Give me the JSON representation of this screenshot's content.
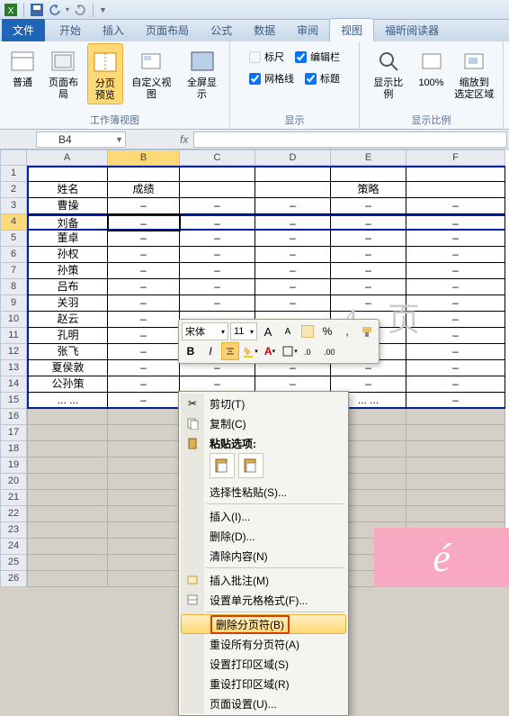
{
  "titlebar": {
    "app_icon": "excel-icon",
    "save_icon": "save-icon",
    "undo_icon": "undo-icon",
    "redo_icon": "redo-icon"
  },
  "tabs": {
    "file": "文件",
    "items": [
      "开始",
      "插入",
      "页面布局",
      "公式",
      "数据",
      "审阅",
      "视图",
      "福昕阅读器"
    ],
    "active_index": 6
  },
  "ribbon": {
    "group1": {
      "normal": "普通",
      "page_layout": "页面布局",
      "page_break": "分页\n预览",
      "custom_view": "自定义视图",
      "full_screen": "全屏显示",
      "label": "工作簿视图"
    },
    "group2": {
      "ruler": "标尺",
      "formula_bar": "编辑栏",
      "gridlines": "网格线",
      "headings": "标题",
      "label": "显示"
    },
    "group3": {
      "zoom": "显示比例",
      "hundred": "100%",
      "zoom_selection": "缩放到\n选定区域",
      "label": "显示比例"
    }
  },
  "namebox": {
    "value": "B4",
    "fx": "fx"
  },
  "columns": [
    "A",
    "B",
    "C",
    "D",
    "E",
    "F"
  ],
  "col_header_b": "成绩",
  "col_header_e": "策略",
  "rows": [
    {
      "n": 1,
      "a": "",
      "b": "",
      "c": "",
      "d": "",
      "e": "",
      "f": ""
    },
    {
      "n": 2,
      "a": "姓名",
      "b": "成绩",
      "c": "",
      "d": "",
      "e": "策略",
      "f": ""
    },
    {
      "n": 3,
      "a": "曹操",
      "b": "–",
      "c": "–",
      "d": "–",
      "e": "–",
      "f": "–"
    },
    {
      "n": 4,
      "a": "刘备",
      "b": "–",
      "c": "–",
      "d": "–",
      "e": "–",
      "f": "–"
    },
    {
      "n": 5,
      "a": "董卓",
      "b": "–",
      "c": "–",
      "d": "–",
      "e": "–",
      "f": "–"
    },
    {
      "n": 6,
      "a": "孙权",
      "b": "–",
      "c": "–",
      "d": "–",
      "e": "–",
      "f": "–"
    },
    {
      "n": 7,
      "a": "孙策",
      "b": "–",
      "c": "–",
      "d": "–",
      "e": "–",
      "f": "–"
    },
    {
      "n": 8,
      "a": "吕布",
      "b": "–",
      "c": "–",
      "d": "–",
      "e": "–",
      "f": "–"
    },
    {
      "n": 9,
      "a": "关羽",
      "b": "–",
      "c": "–",
      "d": "–",
      "e": "–",
      "f": "–"
    },
    {
      "n": 10,
      "a": "赵云",
      "b": "–",
      "c": "–",
      "d": "–",
      "e": "–",
      "f": "–"
    },
    {
      "n": 11,
      "a": "孔明",
      "b": "–",
      "c": "–",
      "d": "–",
      "e": "–",
      "f": "–"
    },
    {
      "n": 12,
      "a": "张飞",
      "b": "–",
      "c": "–",
      "d": "–",
      "e": "–",
      "f": "–"
    },
    {
      "n": 13,
      "a": "夏侯敦",
      "b": "–",
      "c": "–",
      "d": "–",
      "e": "–",
      "f": "–"
    },
    {
      "n": 14,
      "a": "公孙策",
      "b": "–",
      "c": "–",
      "d": "–",
      "e": "–",
      "f": "–"
    },
    {
      "n": 15,
      "a": "... ...",
      "b": "–",
      "c": "–",
      "d": "–",
      "e": "... ...",
      "f": "–"
    }
  ],
  "extra_rows": [
    16,
    17,
    18,
    19,
    20,
    21,
    22,
    23,
    24,
    25,
    26
  ],
  "watermark": "4 页",
  "mini_toolbar": {
    "font": "宋体",
    "size": "11",
    "grow": "A",
    "shrink": "A",
    "percent": "%",
    "comma": ",",
    "bold": "B",
    "italic": "I"
  },
  "context_menu": {
    "cut": "剪切(T)",
    "copy": "复制(C)",
    "paste_options_label": "粘贴选项:",
    "paste_special": "选择性粘贴(S)...",
    "insert": "插入(I)...",
    "delete": "删除(D)...",
    "clear": "清除内容(N)",
    "insert_comment": "插入批注(M)",
    "format_cells": "设置单元格格式(F)...",
    "remove_page_break": "删除分页符(B)",
    "reset_all_breaks": "重设所有分页符(A)",
    "set_print_area": "设置打印区域(S)",
    "reset_print_area": "重设打印区域(R)",
    "page_setup": "页面设置(U)..."
  }
}
